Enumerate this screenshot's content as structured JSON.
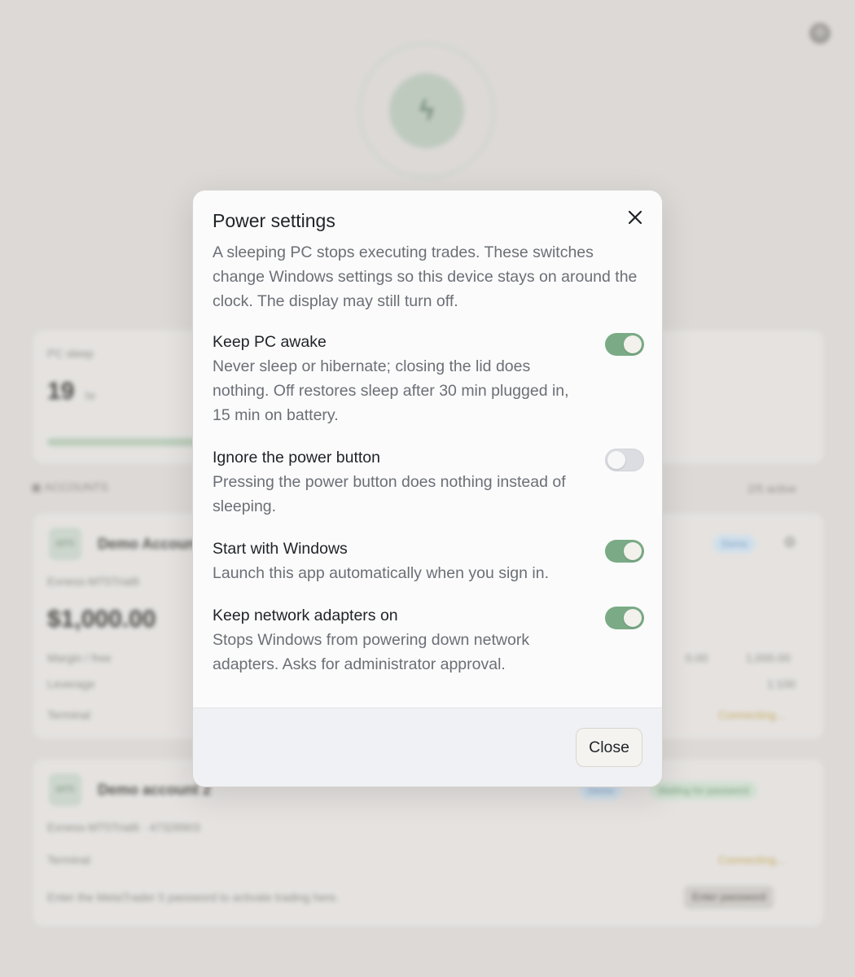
{
  "background": {
    "stat_label": "PC sleep",
    "stat_value": "19",
    "stat_unit": "hr",
    "accounts_header": "ACCOUNTS",
    "accounts_count": "2/5 active",
    "account1": {
      "avatar": "MT5",
      "name": "Demo Account 1",
      "server": "Exness-MT5Trial6",
      "badge": "Demo",
      "balance": "$1,000.00",
      "row1_label": "Margin / free",
      "row1_value1": "0.00",
      "row1_value2": "1,000.00",
      "row2_label": "Leverage",
      "row2_value": "1:100",
      "row3_label": "Terminal",
      "row3_value": "Connecting..."
    },
    "account2": {
      "avatar": "MT5",
      "name": "Demo account 2",
      "server": "Exness-MT5Trial6 · 47328903",
      "badge": "Demo",
      "status": "Waiting for password",
      "row_label": "Terminal",
      "row_value": "Connecting...",
      "hint": "Enter the MetaTrader 5 password to activate trading here.",
      "button": "Enter password"
    }
  },
  "modal": {
    "title": "Power settings",
    "description": "A sleeping PC stops executing trades. These switches change Windows settings so this device stays on around the clock. The display may still turn off.",
    "settings": [
      {
        "title": "Keep PC awake",
        "description": "Never sleep or hibernate; closing the lid does nothing. Off restores sleep after 30 min plugged in, 15 min on battery.",
        "enabled": true
      },
      {
        "title": "Ignore the power button",
        "description": "Pressing the power button does nothing instead of sleeping.",
        "enabled": false
      },
      {
        "title": "Start with Windows",
        "description": "Launch this app automatically when you sign in.",
        "enabled": true
      },
      {
        "title": "Keep network adapters on",
        "description": "Stops Windows from powering down network adapters. Asks for administrator approval.",
        "enabled": true
      }
    ],
    "close_label": "Close"
  },
  "colors": {
    "toggle_on": "#7aab86",
    "toggle_off": "#dcdde2",
    "backdrop": "#dcd9d6"
  },
  "icons": {
    "close": "close-icon",
    "gear": "gear-icon",
    "power": "activity-icon"
  }
}
